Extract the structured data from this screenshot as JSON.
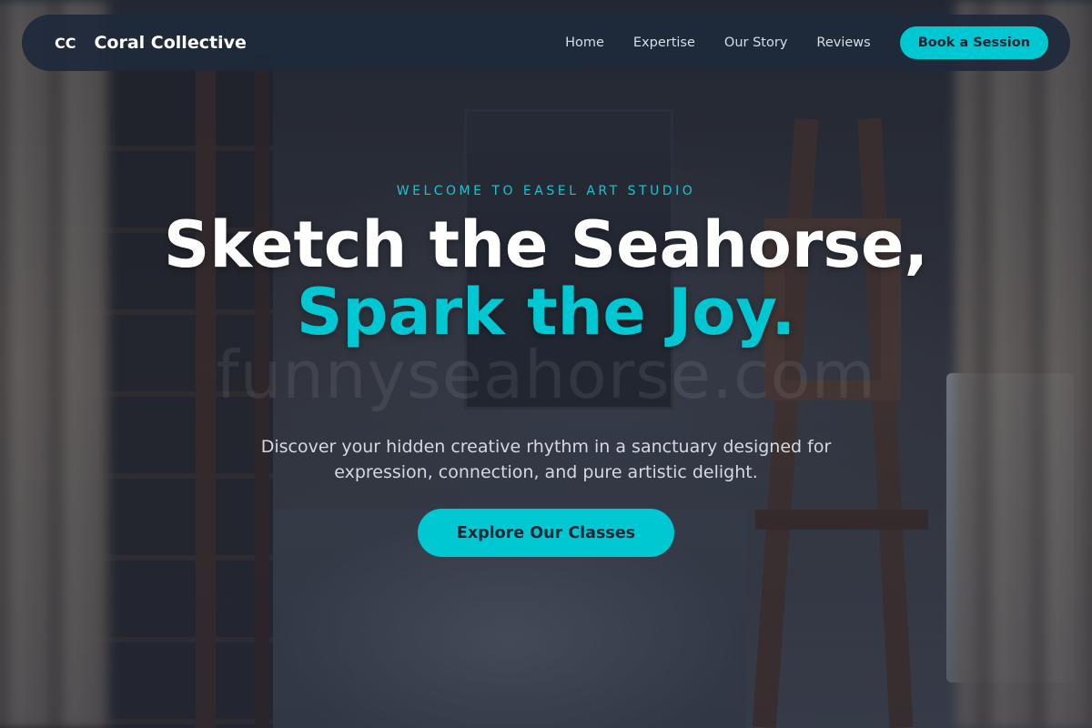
{
  "nav": {
    "logo_mark": "CC",
    "brand": "Coral Collective",
    "links": [
      "Home",
      "Expertise",
      "Our Story",
      "Reviews"
    ],
    "cta": "Book a Session"
  },
  "hero": {
    "eyebrow": "WELCOME TO EASEL ART STUDIO",
    "headline_part1": "Sketch the Seahorse, ",
    "headline_accent": "Spark the Joy.",
    "subtitle": "Discover your hidden creative rhythm in a sanctuary designed for expression, connection, and pure artistic delight.",
    "cta": "Explore Our Classes"
  },
  "watermark": "funnyseahorse.com",
  "colors": {
    "accent": "#00c8d2",
    "nav_bg": "#1e293b",
    "text_light": "#ffffff"
  }
}
